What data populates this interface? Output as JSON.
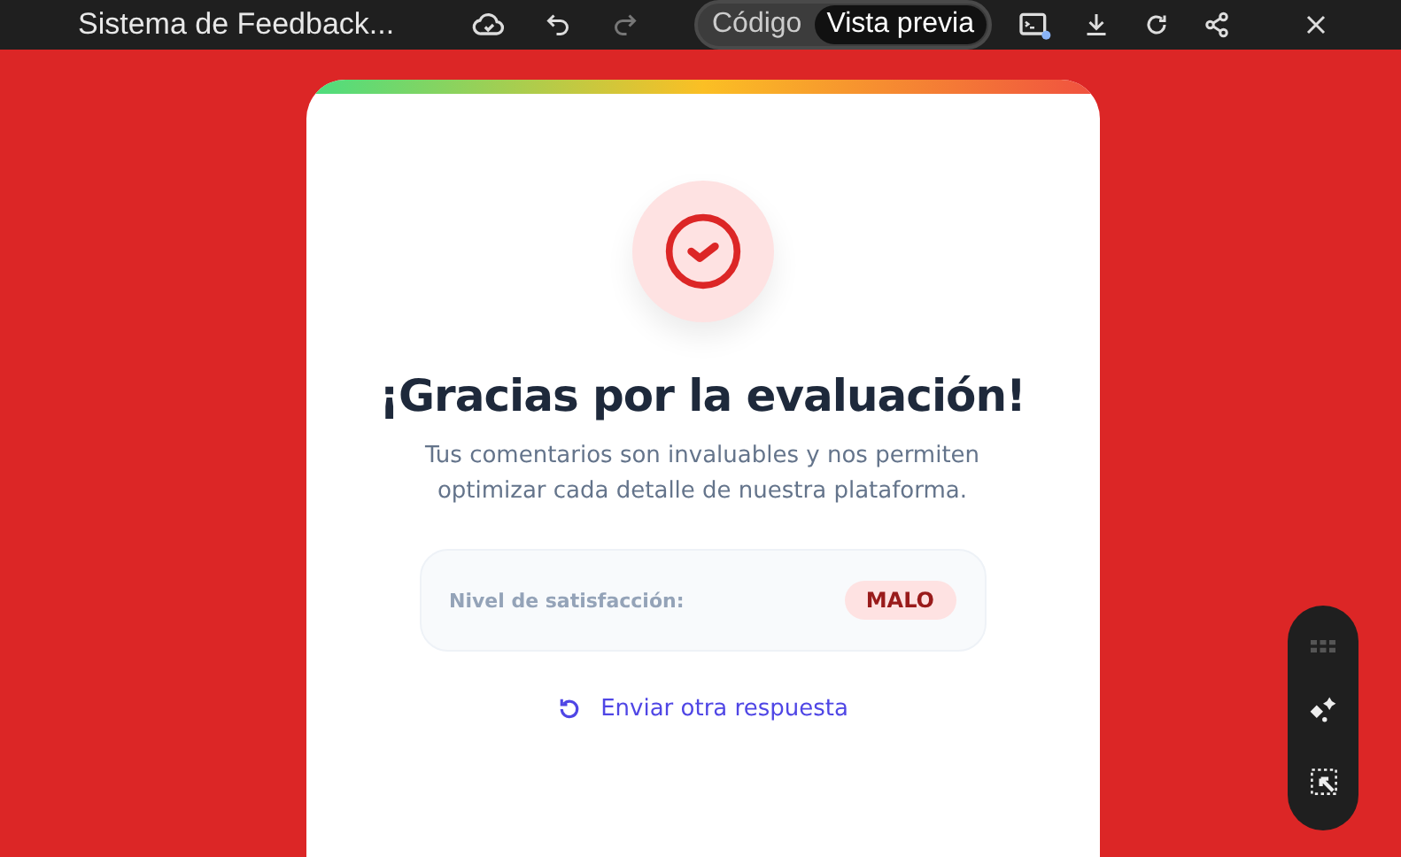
{
  "window": {
    "title": "Sistema de Feedback..."
  },
  "view_tabs": [
    {
      "label": "Código",
      "selected": false
    },
    {
      "label": "Vista previa",
      "selected": true
    }
  ],
  "card": {
    "title": "¡Gracias por la evaluación!",
    "message": "Tus comentarios son invaluables y nos permiten optimizar cada detalle de nuestra plataforma.",
    "satisfaction_label": "Nivel de satisfacción:",
    "satisfaction_value": "MALO",
    "action": "Enviar otra respuesta"
  }
}
